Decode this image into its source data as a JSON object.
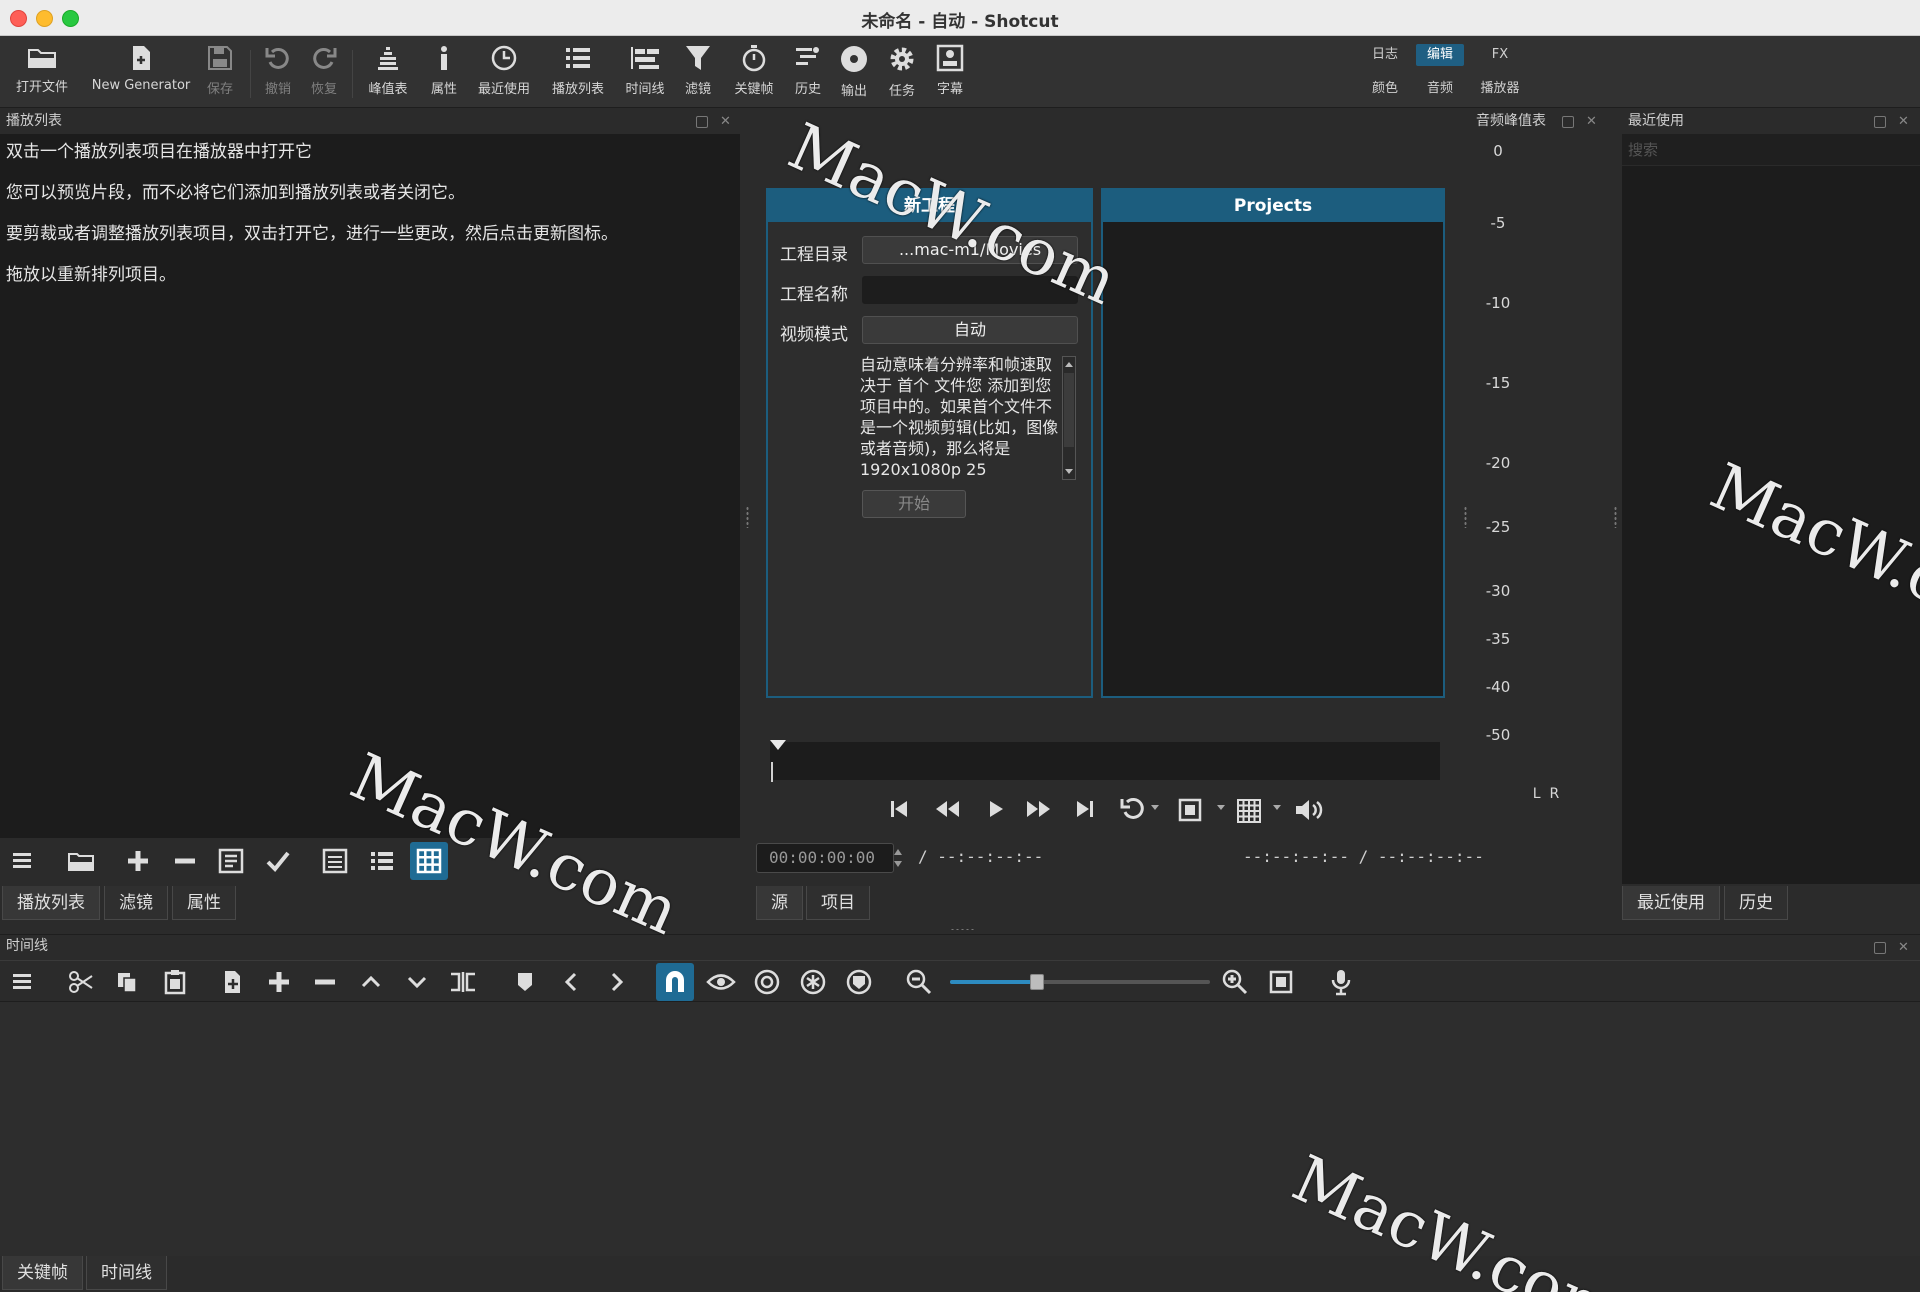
{
  "window": {
    "title": "未命名 - 自动 - Shotcut"
  },
  "toolbar": {
    "open_file": "打开文件",
    "new_generator": "New Generator",
    "save": "保存",
    "undo": "撤销",
    "redo": "恢复",
    "peak_meter": "峰值表",
    "properties": "属性",
    "recent": "最近使用",
    "playlist": "播放列表",
    "timeline": "时间线",
    "filters": "滤镜",
    "keyframes": "关键帧",
    "history": "历史",
    "export": "输出",
    "jobs": "任务",
    "subtitles": "字幕"
  },
  "modes": {
    "logging": "日志",
    "editing": "编辑",
    "fx": "FX",
    "color": "颜色",
    "audio": "音频",
    "player": "播放器"
  },
  "playlist_panel": {
    "title": "播放列表",
    "hints": [
      "双击一个播放列表项目在播放器中打开它",
      "您可以预览片段，而不必将它们添加到播放列表或者关闭它。",
      "要剪裁或者调整播放列表项目，双击打开它，进行一些更改，然后点击更新图标。",
      "拖放以重新排列项目。"
    ],
    "tabs": [
      "播放列表",
      "滤镜",
      "属性"
    ]
  },
  "new_project": {
    "header": "新工程",
    "dir_label": "工程目录",
    "dir_value": "...mac-m1/Movies",
    "name_label": "工程名称",
    "name_value": "",
    "mode_label": "视频模式",
    "mode_value": "自动",
    "description": "自动意味着分辨率和帧速取决于 首个 文件您 添加到您项目中的。如果首个文件不是一个视频剪辑(比如，图像或者音频)，那么将是 1920x1080p 25",
    "start_button": "开始"
  },
  "projects_panel": {
    "header": "Projects"
  },
  "player": {
    "timecode": "00:00:00:00",
    "duration": "/ --:--:--:--",
    "in_out": "--:--:--:-- / --:--:--:--",
    "tabs": [
      "源",
      "项目"
    ]
  },
  "audio_meter": {
    "title": "音频峰值表",
    "scale": [
      "0",
      "-5",
      "-10",
      "-15",
      "-20",
      "-25",
      "-30",
      "-35",
      "-40",
      "-50"
    ],
    "channels": "L  R"
  },
  "recent_panel": {
    "title": "最近使用",
    "search_placeholder": "搜索",
    "tabs": [
      "最近使用",
      "历史"
    ]
  },
  "timeline_panel": {
    "title": "时间线",
    "tabs": [
      "关键帧",
      "时间线"
    ]
  },
  "watermark": "MacW.com"
}
